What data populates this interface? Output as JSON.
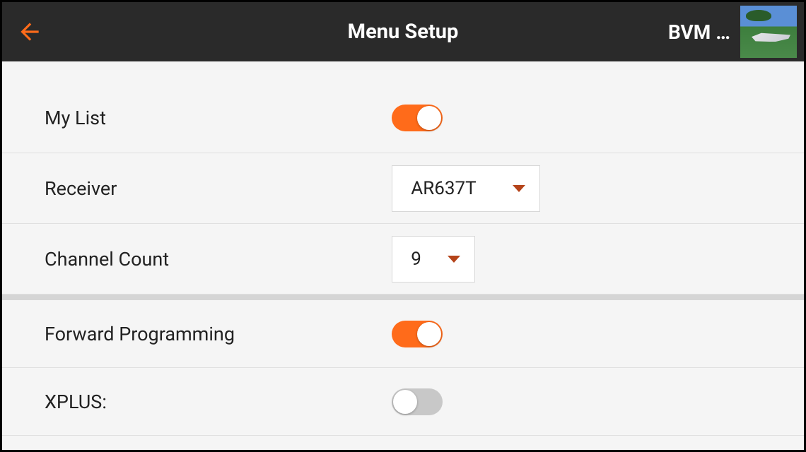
{
  "header": {
    "title": "Menu Setup",
    "model_name": "BVM …"
  },
  "rows": {
    "mylist": {
      "label": "My List",
      "on": true
    },
    "receiver": {
      "label": "Receiver",
      "value": "AR637T"
    },
    "channel_count": {
      "label": "Channel Count",
      "value": "9"
    },
    "forward_programming": {
      "label": "Forward Programming",
      "on": true
    },
    "xplus": {
      "label": "XPLUS:",
      "on": false
    }
  },
  "colors": {
    "accent": "#ff6b1a",
    "caret": "#b5441a"
  }
}
